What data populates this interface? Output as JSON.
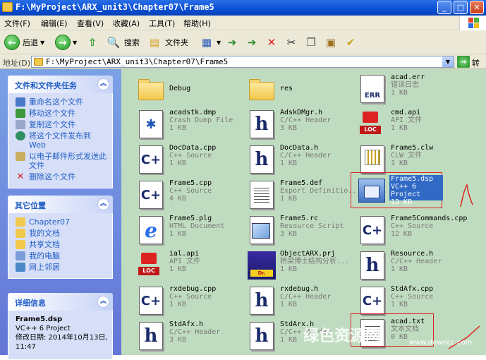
{
  "window": {
    "title": "F:\\MyProject\\ARX_unit3\\Chapter07\\Frame5"
  },
  "window_buttons": {
    "min": "_",
    "max": "□",
    "close": "✕"
  },
  "menu": [
    "文件(F)",
    "编辑(E)",
    "查看(V)",
    "收藏(A)",
    "工具(T)",
    "帮助(H)"
  ],
  "toolbar": {
    "back": "后退",
    "search": "搜索",
    "folders": "文件夹"
  },
  "address": {
    "label": "地址(D)",
    "value": "F:\\MyProject\\ARX_unit3\\Chapter07\\Frame5",
    "go": "转到"
  },
  "tasks": {
    "title": "文件和文件夹任务",
    "items": [
      "重命名这个文件",
      "移动这个文件",
      "复制这个文件",
      "将这个文件发布到 Web",
      "以电子邮件形式发送此文件",
      "删除这个文件"
    ]
  },
  "places": {
    "title": "其它位置",
    "items": [
      "Chapter07",
      "我的文档",
      "共享文档",
      "我的电脑",
      "网上邻居"
    ]
  },
  "details": {
    "title": "详细信息",
    "name": "Frame5.dsp",
    "type": "VC++ 6 Project",
    "modified": "修改日期: 2014年10月13日, 11:47"
  },
  "files": [
    {
      "name": "Debug",
      "type": "",
      "size": "",
      "icon": "folder"
    },
    {
      "name": "res",
      "type": "",
      "size": "",
      "icon": "folder"
    },
    {
      "name": "acad.err",
      "type": "错误日志",
      "size": "1 KB",
      "icon": "err"
    },
    {
      "name": "acadstk.dmp",
      "type": "Crash Dump File",
      "size": "1 KB",
      "icon": "dmp"
    },
    {
      "name": "AdskDMgr.h",
      "type": "C/C++ Header",
      "size": "3 KB",
      "icon": "h"
    },
    {
      "name": "cmd.api",
      "type": "API 文件",
      "size": "1 KB",
      "icon": "api"
    },
    {
      "name": "DocData.cpp",
      "type": "C++ Source",
      "size": "1 KB",
      "icon": "cpp"
    },
    {
      "name": "DocData.h",
      "type": "C/C++ Header",
      "size": "1 KB",
      "icon": "h"
    },
    {
      "name": "Frame5.clw",
      "type": "CLW 文件",
      "size": "1 KB",
      "icon": "clw"
    },
    {
      "name": "Frame5.cpp",
      "type": "C++ Source",
      "size": "4 KB",
      "icon": "cpp"
    },
    {
      "name": "Frame5.def",
      "type": "Export Definitio...",
      "size": "1 KB",
      "icon": "def"
    },
    {
      "name": "Frame5.dsp",
      "type": "VC++ 6 Project",
      "size": "13 KB",
      "icon": "dsp"
    },
    {
      "name": "Frame5.plg",
      "type": "HTML Document",
      "size": "1 KB",
      "icon": "ie"
    },
    {
      "name": "Frame5.rc",
      "type": "Resource Script",
      "size": "3 KB",
      "icon": "rc"
    },
    {
      "name": "Frame5Commands.cpp",
      "type": "C++ Source",
      "size": "12 KB",
      "icon": "cpp"
    },
    {
      "name": "ial.api",
      "type": "API 文件",
      "size": "1 KB",
      "icon": "api"
    },
    {
      "name": "ObjectARX.prj",
      "type": "桥梁博士结构分析...",
      "size": "1 KB",
      "icon": "prj"
    },
    {
      "name": "Resource.h",
      "type": "C/C++ Header",
      "size": "1 KB",
      "icon": "h"
    },
    {
      "name": "rxdebug.cpp",
      "type": "C++ Source",
      "size": "1 KB",
      "icon": "cpp"
    },
    {
      "name": "rxdebug.h",
      "type": "C/C++ Header",
      "size": "1 KB",
      "icon": "h"
    },
    {
      "name": "StdAfx.cpp",
      "type": "C++ Source",
      "size": "1 KB",
      "icon": "cpp"
    },
    {
      "name": "StdAfx.h",
      "type": "C/C++ Header",
      "size": "3 KB",
      "icon": "h"
    },
    {
      "name": "StdArx.h",
      "type": "C/C++ Header",
      "size": "1 KB",
      "icon": "h"
    },
    {
      "name": "acad.txt",
      "type": "文本文档",
      "size": "0 KB",
      "icon": "txt"
    }
  ],
  "watermark": {
    "text": "绿色资源网",
    "url": "www.downcc.com"
  },
  "colors": {
    "titlebar": "#0a4fd4",
    "leftpane": "#6f8ee0",
    "content_bg": "#c0dcc0",
    "selection": "#316ac5",
    "annotation": "#dd2222"
  }
}
